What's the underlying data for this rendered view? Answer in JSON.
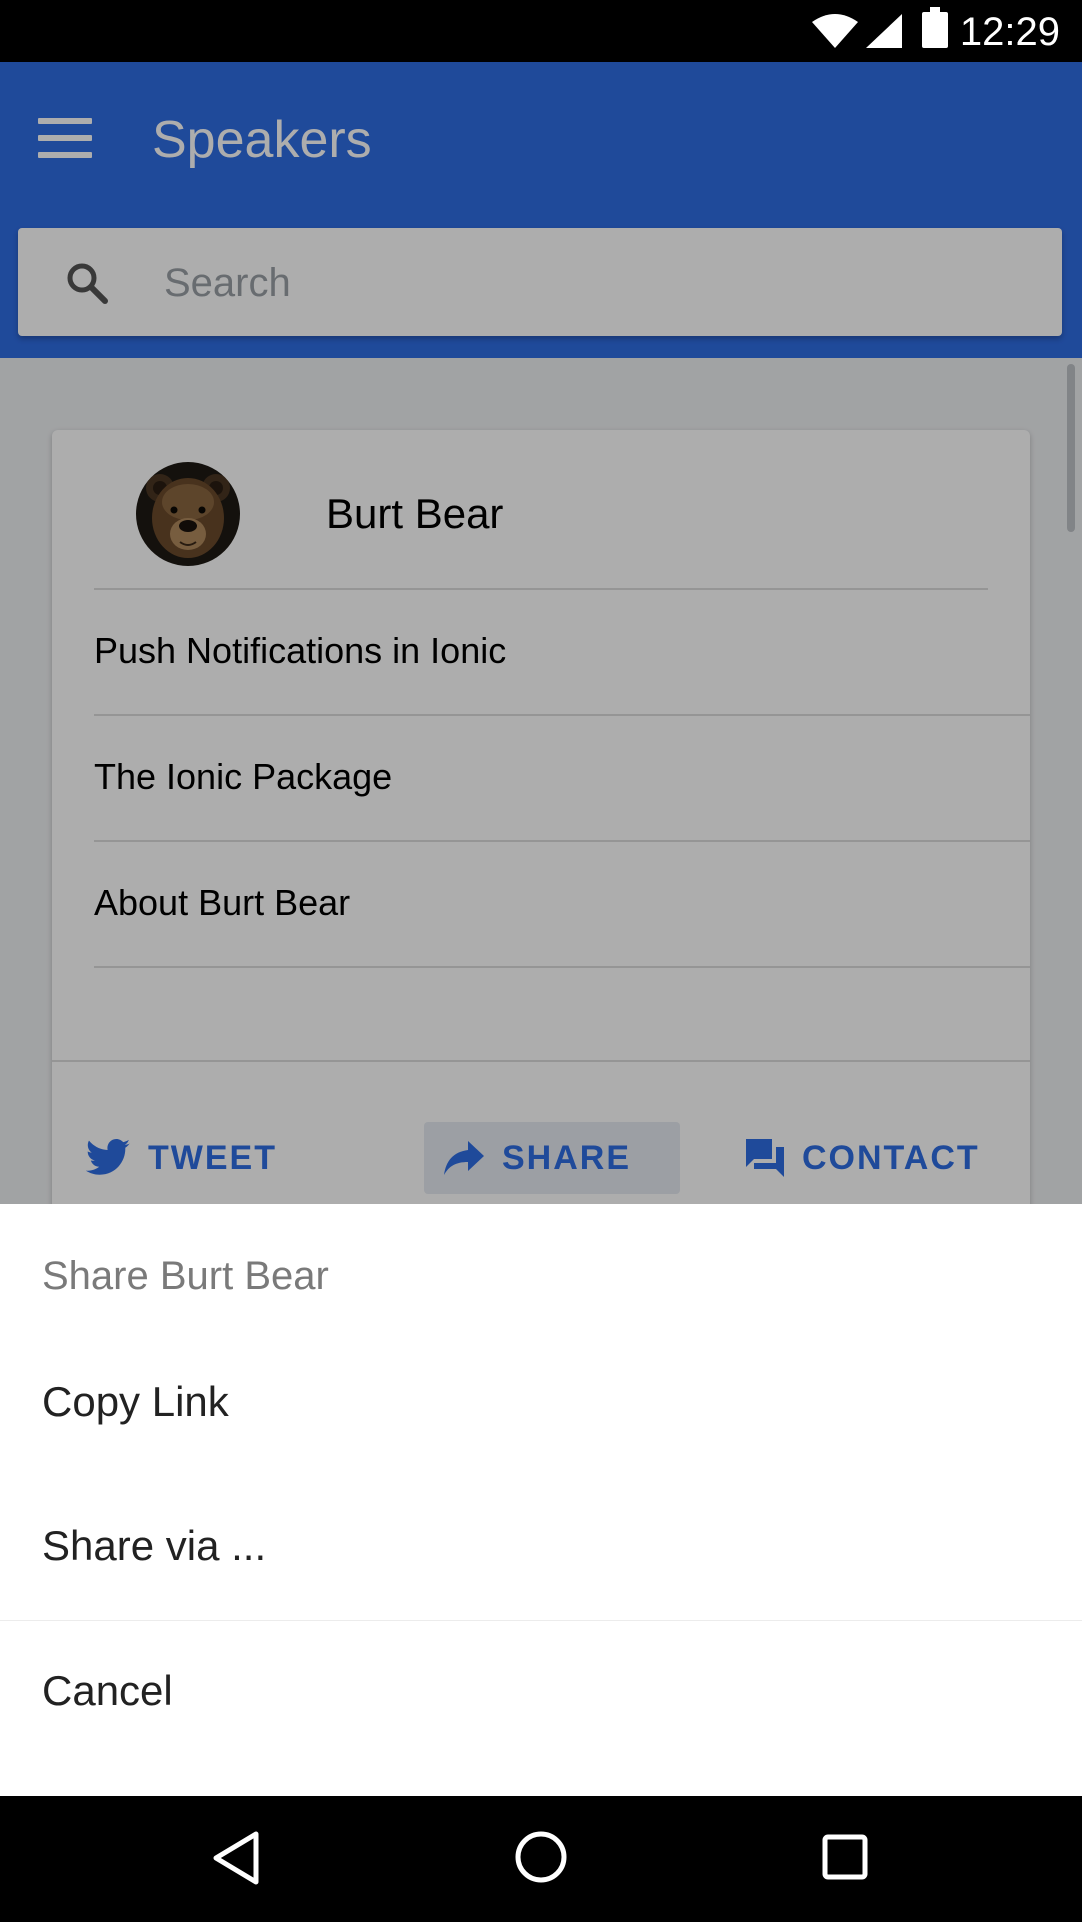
{
  "status_bar": {
    "time": "12:29"
  },
  "toolbar": {
    "title": "Speakers",
    "menu_icon": "menu-icon"
  },
  "search": {
    "placeholder": "Search",
    "value": "",
    "icon": "search-icon"
  },
  "speaker_card": {
    "name": "Burt Bear",
    "avatar": "bear-avatar",
    "sessions": [
      {
        "label": "Push Notifications in Ionic"
      },
      {
        "label": "The Ionic Package"
      },
      {
        "label": "About Burt Bear"
      }
    ],
    "actions": {
      "tweet_label": "TWEET",
      "share_label": "SHARE",
      "contact_label": "CONTACT"
    }
  },
  "action_sheet": {
    "title": "Share Burt Bear",
    "items": [
      {
        "label": "Copy Link"
      },
      {
        "label": "Share via ..."
      }
    ],
    "cancel_label": "Cancel"
  },
  "colors": {
    "primary": "#2f6de4",
    "backdrop": "rgba(0,0,0,0.32)",
    "sheet_background": "#ffffff"
  }
}
